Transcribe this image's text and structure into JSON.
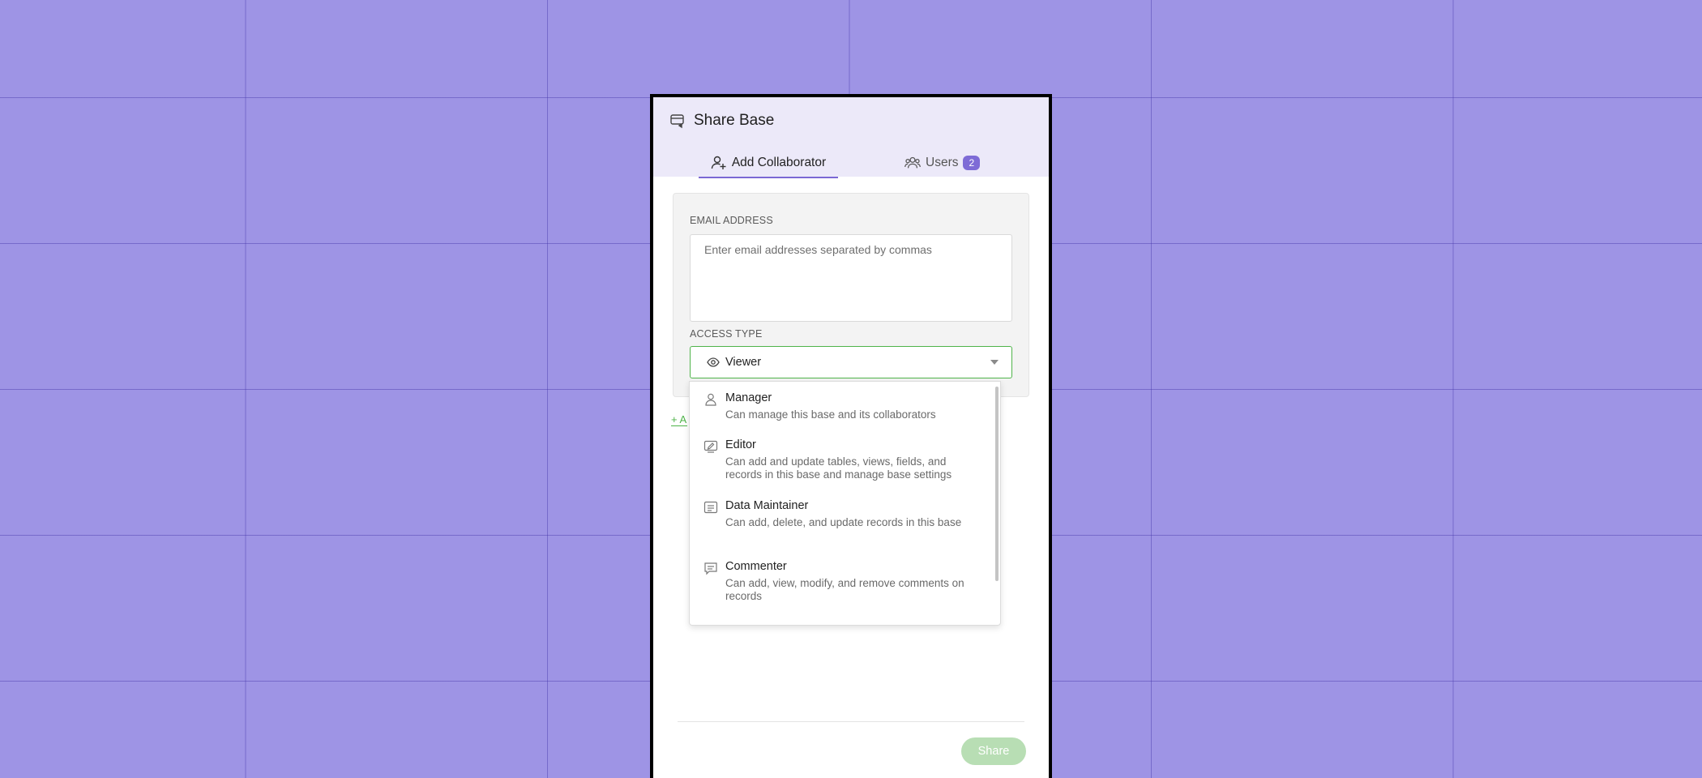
{
  "modal": {
    "title": "Share Base",
    "tabs": {
      "add_collaborator": "Add Collaborator",
      "users": "Users",
      "users_count": "2"
    },
    "email": {
      "label": "EMAIL ADDRESS",
      "placeholder": "Enter email addresses separated by commas",
      "value": ""
    },
    "access": {
      "label": "ACCESS TYPE",
      "selected": "Viewer"
    },
    "add_more": "+ A",
    "dropdown": {
      "options": [
        {
          "name": "Manager",
          "description": "Can manage this base and its collaborators",
          "icon": "user-icon"
        },
        {
          "name": "Editor",
          "description": "Can add and update tables, views, fields, and records in this base and manage base settings",
          "icon": "editor-icon"
        },
        {
          "name": "Data Maintainer",
          "description": "Can add, delete, and update records in this base",
          "icon": "data-icon"
        },
        {
          "name": "Commenter",
          "description": "Can add, view, modify, and remove comments on records",
          "icon": "comment-icon"
        }
      ]
    },
    "share_button": "Share"
  },
  "colors": {
    "background": "#9e94e5",
    "header": "#ece9f9",
    "accent": "#7b68d4",
    "select_border": "#4fb44a",
    "share_disabled": "#b8deb4"
  }
}
